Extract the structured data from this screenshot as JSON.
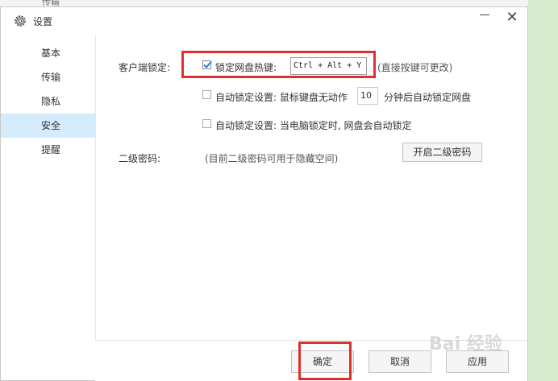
{
  "background": {
    "partial_text": "传输"
  },
  "dialog": {
    "title": "设置",
    "icons": {
      "title": "gear-icon",
      "minimize": "minimize-icon",
      "close": "close-icon"
    },
    "close_glyph": "✕"
  },
  "sidebar": {
    "items": [
      {
        "label": "基本"
      },
      {
        "label": "传输"
      },
      {
        "label": "隐私"
      },
      {
        "label": "安全",
        "active": true
      },
      {
        "label": "提醒"
      }
    ]
  },
  "security": {
    "client_lock_label": "客户端锁定:",
    "hotkey_option": {
      "label": "锁定网盘热键:",
      "checked": true,
      "value": "Ctrl + Alt + Y",
      "hint": "(直接按键可更改)"
    },
    "auto_lock_idle": {
      "label_before": "自动锁定设置: 鼠标键盘无动作",
      "minutes": "10",
      "label_after": "分钟后自动锁定网盘",
      "checked": false
    },
    "auto_lock_pc": {
      "label": "自动锁定设置: 当电脑锁定时, 网盘会自动锁定",
      "checked": false
    },
    "second_password": {
      "label": "二级密码:",
      "hint": "(目前二级密码可用于隐藏空间)",
      "button": "开启二级密码"
    }
  },
  "footer": {
    "ok": "确定",
    "cancel": "取消",
    "apply": "应用"
  },
  "watermark": {
    "text": "Bai 经验"
  },
  "colors": {
    "highlight": "#e0302d",
    "active_tab": "#d4ecfb",
    "background": "#d7ebcf"
  }
}
